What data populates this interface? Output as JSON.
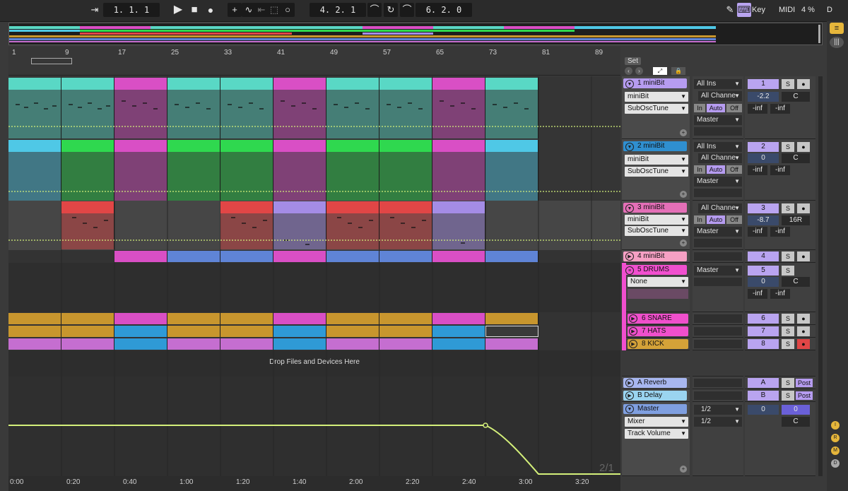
{
  "transport": {
    "position": "1.  1.  1",
    "loop_start": "4.  2.  1",
    "loop_length": "6.  2.  0",
    "key_label": "Key",
    "midi_label": "MIDI",
    "cpu": "4 %",
    "d_label": "D"
  },
  "ruler": {
    "bars": [
      "1",
      "9",
      "17",
      "25",
      "33",
      "41",
      "49",
      "57",
      "65",
      "73",
      "81",
      "89"
    ]
  },
  "set": {
    "label": "Set"
  },
  "drop_hint": "Drop Files and Devices Here",
  "time_ruler": [
    "0:00",
    "0:20",
    "0:40",
    "1:00",
    "1:20",
    "1:40",
    "2:00",
    "2:20",
    "2:40",
    "3:00",
    "3:20"
  ],
  "page_indicator": "2/1",
  "tracks": [
    {
      "title": "1 miniBit",
      "color": "#b69cf0",
      "device": "miniBit",
      "param": "SubOscTune",
      "input": "All Ins",
      "channel": "All Channe",
      "mon": [
        "In",
        "Auto",
        "Off"
      ],
      "output": "Master",
      "num": "1",
      "vol": "-2.2",
      "pan": "C",
      "peak_l": "-inf",
      "peak_r": "-inf"
    },
    {
      "title": "2 miniBit",
      "color": "#2f8fd0",
      "device": "miniBit",
      "param": "SubOscTune",
      "input": "All Ins",
      "channel": "All Channe",
      "mon": [
        "In",
        "Auto",
        "Off"
      ],
      "output": "Master",
      "num": "2",
      "vol": "0",
      "pan": "C",
      "peak_l": "-inf",
      "peak_r": "-inf"
    },
    {
      "title": "3 miniBit",
      "color": "#e46fb7",
      "device": "miniBit",
      "param": "SubOscTune",
      "channel": "All Channe",
      "mon": [
        "In",
        "Auto",
        "Off"
      ],
      "output": "Master",
      "num": "3",
      "vol": "-8.7",
      "pan": "16R",
      "peak_l": "-inf",
      "peak_r": "-inf"
    },
    {
      "title": "4 miniBit",
      "color": "#f6a0c4",
      "num": "4"
    },
    {
      "title": "5 DRUMS",
      "color": "#f14fcf",
      "device": "None",
      "output": "Master",
      "num": "5",
      "vol": "0",
      "pan": "C",
      "peak_l": "-inf",
      "peak_r": "-inf"
    },
    {
      "title": "6 SNARE",
      "color": "#f04fcc",
      "num": "6"
    },
    {
      "title": "7 HATS",
      "color": "#f04fcc",
      "num": "7"
    },
    {
      "title": "8 KICK",
      "color": "#d4a238",
      "num": "8"
    },
    {
      "title": "A Reverb",
      "color": "#a8b7f0",
      "num": "A",
      "send": "Post"
    },
    {
      "title": "B Delay",
      "color": "#9ad4f0",
      "num": "B",
      "send": "Post"
    },
    {
      "title": "Master",
      "color": "#7f9fe0",
      "device": "Mixer",
      "param": "Track Volume",
      "in1": "1/2",
      "in2": "1/2",
      "num": "0",
      "vol": "0",
      "pan": "C"
    }
  ],
  "colors": {
    "teal": "#59d8c5",
    "magenta": "#d94fc5",
    "cyan": "#4fc8e6",
    "green": "#2fd84f",
    "red": "#e14646",
    "lavender": "#a48ce6",
    "blue": "#5f84d6",
    "gold": "#c8962e",
    "sky": "#2f9ad6",
    "orchid": "#c56ed0",
    "automation": "#d4f07a"
  },
  "right_icons": [
    "I",
    "R",
    "M",
    "D"
  ]
}
